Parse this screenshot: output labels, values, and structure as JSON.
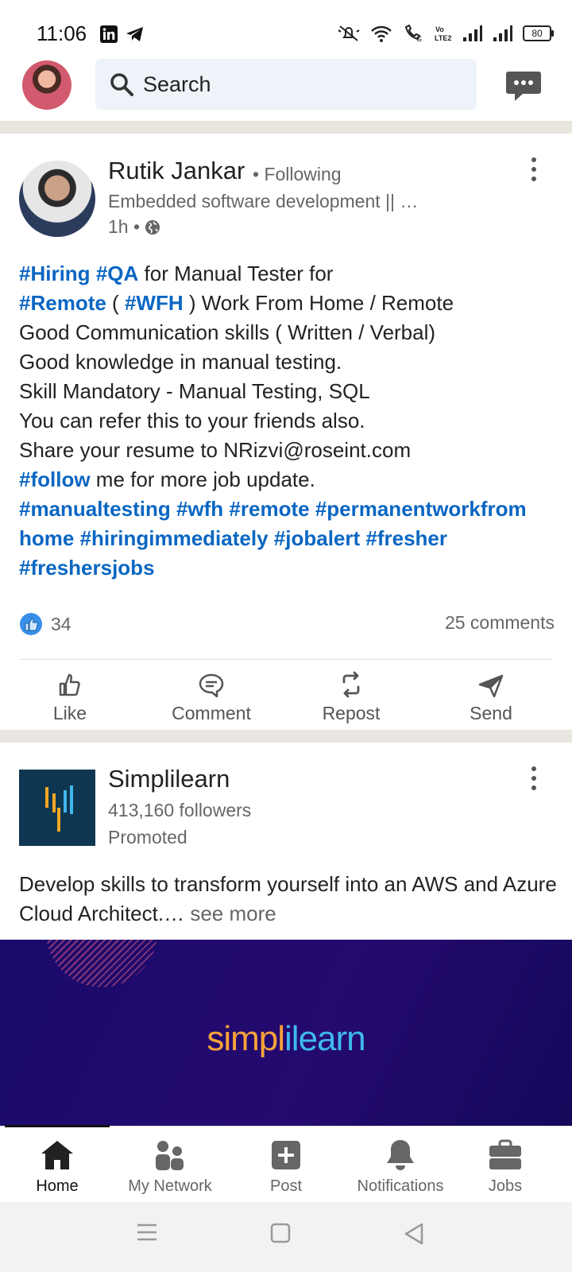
{
  "status_bar": {
    "time": "11:06",
    "battery": "80"
  },
  "header": {
    "search_placeholder": "Search"
  },
  "post": {
    "author": "Rutik Jankar",
    "following": "• Following",
    "headline": "Embedded software development || …",
    "time": "1h •",
    "lines": [
      [
        {
          "t": "#Hiring",
          "tag": true
        },
        {
          "t": " "
        },
        {
          "t": "#QA",
          "tag": true
        },
        {
          "t": " for Manual Tester for"
        }
      ],
      [
        {
          "t": "#Remote",
          "tag": true
        },
        {
          "t": " ( "
        },
        {
          "t": "#WFH",
          "tag": true
        },
        {
          "t": " ) Work From Home / Remote"
        }
      ],
      [
        {
          "t": "Good Communication skills ( Written / Verbal)"
        }
      ],
      [
        {
          "t": "Good knowledge in manual testing."
        }
      ],
      [
        {
          "t": "Skill Mandatory - Manual Testing, SQL"
        }
      ],
      [
        {
          "t": "You can refer this to your friends also."
        }
      ],
      [
        {
          "t": "Share your resume to NRizvi@roseint.com"
        }
      ],
      [
        {
          "t": "#follow",
          "tag": true
        },
        {
          "t": " me for more job update."
        }
      ],
      [
        {
          "t": "#manualtesting",
          "tag": true
        },
        {
          "t": " "
        },
        {
          "t": "#wfh",
          "tag": true
        },
        {
          "t": " "
        },
        {
          "t": "#remote",
          "tag": true
        },
        {
          "t": " "
        },
        {
          "t": "#permanentworkfrom",
          "tag": true
        }
      ],
      [
        {
          "t": "home",
          "tag": true
        },
        {
          "t": " "
        },
        {
          "t": "#hiringimmediately",
          "tag": true
        },
        {
          "t": " "
        },
        {
          "t": "#jobalert",
          "tag": true
        },
        {
          "t": " "
        },
        {
          "t": "#fresher",
          "tag": true
        }
      ],
      [
        {
          "t": "#freshersjobs",
          "tag": true
        }
      ]
    ],
    "reactions": "34",
    "comments": "25 comments",
    "actions": {
      "like": "Like",
      "comment": "Comment",
      "repost": "Repost",
      "send": "Send"
    }
  },
  "promoted_post": {
    "company": "Simplilearn",
    "followers": "413,160 followers",
    "promoted": "Promoted",
    "text": "Develop skills to transform yourself into an AWS and Azure Cloud Architect.…",
    "see_more": " see more",
    "banner_brand_a": "simpl",
    "banner_brand_b": "ilearn"
  },
  "bottom_nav": {
    "home": "Home",
    "network": "My Network",
    "post": "Post",
    "notifications": "Notifications",
    "jobs": "Jobs"
  },
  "colors": {
    "link": "#0a66c2",
    "divider": "#e9e5df",
    "search_bg": "#edf3f8",
    "banner": "#1a0a6b"
  }
}
